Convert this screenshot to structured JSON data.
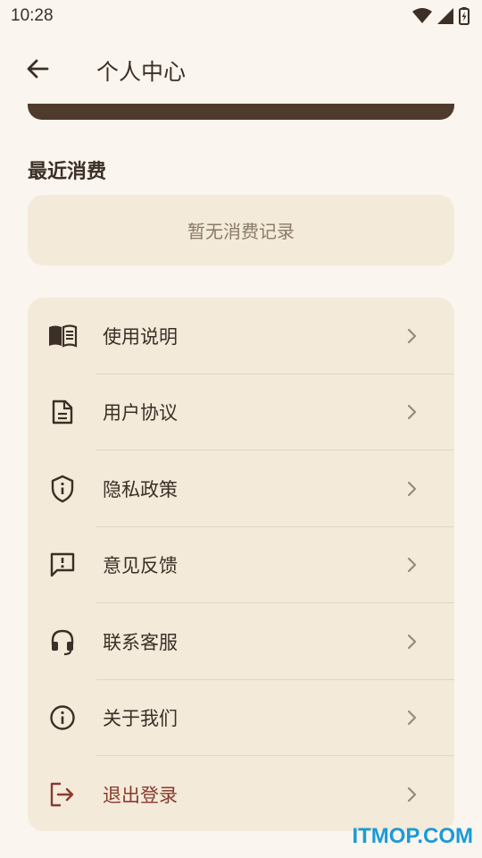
{
  "status_bar": {
    "time": "10:28"
  },
  "header": {
    "title": "个人中心"
  },
  "recent": {
    "title": "最近消费",
    "empty_text": "暂无消费记录"
  },
  "menu": {
    "items": [
      {
        "label": "使用说明",
        "icon": "book-icon"
      },
      {
        "label": "用户协议",
        "icon": "document-icon"
      },
      {
        "label": "隐私政策",
        "icon": "shield-info-icon"
      },
      {
        "label": "意见反馈",
        "icon": "feedback-icon"
      },
      {
        "label": "联系客服",
        "icon": "headset-icon"
      },
      {
        "label": "关于我们",
        "icon": "info-icon"
      },
      {
        "label": "退出登录",
        "icon": "logout-icon"
      }
    ]
  },
  "colors": {
    "accent": "#4f3b2c",
    "danger": "#8a3a2e",
    "card": "#f3ead9",
    "background": "#faf5ee"
  },
  "watermark": "ITMOP.COM"
}
